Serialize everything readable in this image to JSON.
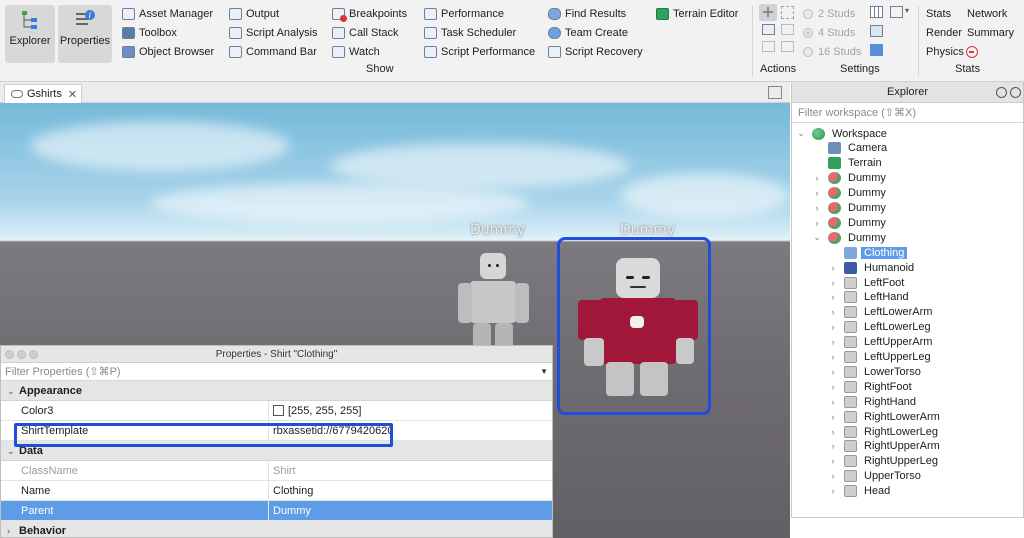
{
  "ribbon": {
    "explorer_label": "Explorer",
    "properties_label": "Properties",
    "col1": [
      "Asset Manager",
      "Toolbox",
      "Object Browser"
    ],
    "col2": [
      "Output",
      "Script Analysis",
      "Command Bar"
    ],
    "col3": [
      "Breakpoints",
      "Call Stack",
      "Watch"
    ],
    "col4": [
      "Performance",
      "Task Scheduler",
      "Script Performance"
    ],
    "col5": [
      "Find Results",
      "Team Create",
      "Script Recovery"
    ],
    "col6": [
      "Terrain Editor"
    ],
    "show_group": "Show",
    "actions_group": "Actions",
    "studs": [
      "2 Studs",
      "4 Studs",
      "16 Studs"
    ],
    "settings_group": "Settings",
    "stats_items": [
      "Stats",
      "Network",
      "Render",
      "Summary",
      "Physics"
    ],
    "stats_group": "Stats"
  },
  "tab": {
    "name": "Gshirts"
  },
  "viewport": {
    "labels": [
      "Dummy",
      "Dummy"
    ]
  },
  "explorer": {
    "title": "Explorer",
    "filter_placeholder": "Filter workspace (⇧⌘X)",
    "tree": [
      {
        "label": "Workspace",
        "arrow": "⌄",
        "icon": "globe-icon"
      },
      {
        "label": "Camera",
        "arrow": "",
        "icon": "camera-icon"
      },
      {
        "label": "Terrain",
        "arrow": "",
        "icon": "terrain-icon"
      },
      {
        "label": "Dummy",
        "arrow": "›",
        "icon": "model-icon"
      },
      {
        "label": "Dummy",
        "arrow": "›",
        "icon": "model-icon"
      },
      {
        "label": "Dummy",
        "arrow": "›",
        "icon": "model-icon"
      },
      {
        "label": "Dummy",
        "arrow": "›",
        "icon": "model-icon"
      },
      {
        "label": "Dummy",
        "arrow": "⌄",
        "icon": "model-icon"
      },
      {
        "label": "Clothing",
        "arrow": "",
        "icon": "shirt-icon"
      },
      {
        "label": "Humanoid",
        "arrow": "›",
        "icon": "humanoid-icon"
      },
      {
        "label": "LeftFoot",
        "arrow": "›",
        "icon": "meshpart-icon"
      },
      {
        "label": "LeftHand",
        "arrow": "›",
        "icon": "meshpart-icon"
      },
      {
        "label": "LeftLowerArm",
        "arrow": "›",
        "icon": "meshpart-icon"
      },
      {
        "label": "LeftLowerLeg",
        "arrow": "›",
        "icon": "meshpart-icon"
      },
      {
        "label": "LeftUpperArm",
        "arrow": "›",
        "icon": "meshpart-icon"
      },
      {
        "label": "LeftUpperLeg",
        "arrow": "›",
        "icon": "meshpart-icon"
      },
      {
        "label": "LowerTorso",
        "arrow": "›",
        "icon": "meshpart-icon"
      },
      {
        "label": "RightFoot",
        "arrow": "›",
        "icon": "meshpart-icon"
      },
      {
        "label": "RightHand",
        "arrow": "›",
        "icon": "meshpart-icon"
      },
      {
        "label": "RightLowerArm",
        "arrow": "›",
        "icon": "meshpart-icon"
      },
      {
        "label": "RightLowerLeg",
        "arrow": "›",
        "icon": "meshpart-icon"
      },
      {
        "label": "RightUpperArm",
        "arrow": "›",
        "icon": "meshpart-icon"
      },
      {
        "label": "RightUpperLeg",
        "arrow": "›",
        "icon": "meshpart-icon"
      },
      {
        "label": "UpperTorso",
        "arrow": "›",
        "icon": "meshpart-icon"
      },
      {
        "label": "Head",
        "arrow": "›",
        "icon": "meshpart-icon"
      }
    ]
  },
  "properties": {
    "title": "Properties - Shirt \"Clothing\"",
    "filter_placeholder": "Filter Properties (⇧⌘P)",
    "appearance": "Appearance",
    "color3_name": "Color3",
    "color3_value": "[255, 255, 255]",
    "shirt_name": "ShirtTemplate",
    "shirt_value": "rbxassetid://6779420620",
    "data": "Data",
    "classname_name": "ClassName",
    "classname_value": "Shirt",
    "name_name": "Name",
    "name_value": "Clothing",
    "parent_name": "Parent",
    "parent_value": "Dummy",
    "behavior": "Behavior"
  },
  "colors": {
    "accent_select": "#5f9ce8",
    "highlight_border": "#1e4fdc",
    "shirt_red": "#a0173a"
  }
}
